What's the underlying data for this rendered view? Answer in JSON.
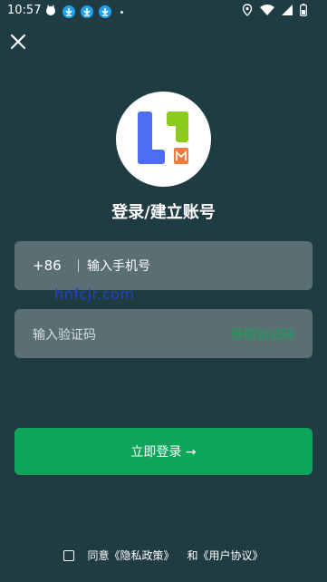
{
  "status_bar": {
    "time": "10:57",
    "left_icons": [
      "cat-icon",
      "download-icon",
      "download-icon",
      "download-icon",
      "dot-icon"
    ],
    "right_icons": [
      "location-icon",
      "wifi-icon",
      "signal-icon",
      "battery-icon"
    ]
  },
  "header": {
    "close_icon": "close-icon"
  },
  "logo": {
    "brand_colors": [
      "#4b6ef5",
      "#8bcb19",
      "#f07a40"
    ]
  },
  "title": "登录/建立账号",
  "phone_field": {
    "country_code": "+86",
    "placeholder": "输入手机号"
  },
  "watermark": "hnfcjr.com",
  "code_field": {
    "placeholder": "输入验证码",
    "get_code_label": "获取验证码"
  },
  "login_button": {
    "label": "立即登录 →"
  },
  "agreement": {
    "agree": "同意",
    "privacy": "《隐私政策》",
    "and": "和",
    "user_agreement": "《用户协议》"
  },
  "colors": {
    "background": "#1f3c43",
    "input_bg": "#5a6f73",
    "primary": "#0ea45a",
    "accent_green_text": "#1aa05a"
  }
}
